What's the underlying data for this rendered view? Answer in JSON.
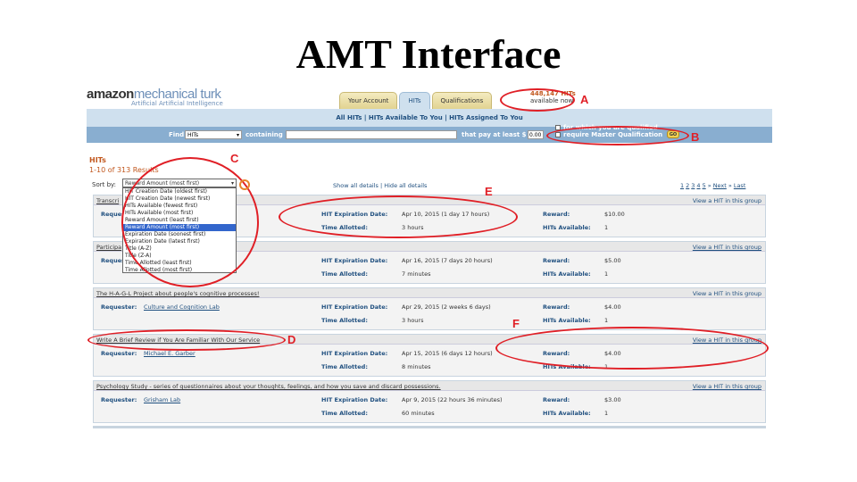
{
  "slide_title": "AMT Interface",
  "logo": {
    "main": "amazon",
    "accent": "mechanical turk",
    "tagline": "Artificial Artificial Intelligence"
  },
  "tabs": [
    "Your Account",
    "HITs",
    "Qualifications"
  ],
  "hit_count": {
    "number": "448,147 HITs",
    "label": "available now"
  },
  "nav": "All HITs  |  HITs Available To You  |  HITs Assigned To You",
  "find": {
    "find_label": "Find",
    "select_value": "HITs",
    "containing_label": "containing",
    "pay_label": "that pay at least $",
    "pay_value": "0.00",
    "qual1": "for which you are qualified",
    "qual2": "require Master Qualification",
    "go": "GO"
  },
  "heading": "HITs",
  "results": "1-10 of 313 Results",
  "sort": {
    "label": "Sort by:",
    "value": "Reward Amount (most first)",
    "options": [
      "HIT Creation Date (oldest first)",
      "HIT Creation Date (newest first)",
      "HITs Available (fewest first)",
      "HITs Available (most first)",
      "Reward Amount (least first)",
      "Reward Amount (most first)",
      "Expiration Date (soonest first)",
      "Expiration Date (latest first)",
      "Title (A-Z)",
      "Title (Z-A)",
      "Time Allotted (least first)",
      "Time Allotted (most first)"
    ]
  },
  "details": "Show all details  |  Hide all details",
  "pager": [
    "1",
    "2",
    "3",
    "4",
    "5",
    "»",
    "Next",
    "»",
    "Last"
  ],
  "labels": {
    "requester": "Requester:",
    "expiration": "HIT Expiration Date:",
    "allotted": "Time Allotted:",
    "reward": "Reward:",
    "available": "HITs Available:"
  },
  "hits": [
    {
      "title": "Transcri",
      "view": "View a HIT in this group",
      "requester": "",
      "expiration": "Apr 10, 2015  (1 day 17 hours)",
      "allotted": "3 hours",
      "reward": "$10.00",
      "available": "1"
    },
    {
      "title": "Participa",
      "view": "View a HIT in this group",
      "requester": "",
      "expiration": "Apr 16, 2015  (7 days 20 hours)",
      "allotted": "7 minutes",
      "reward": "$5.00",
      "available": "1"
    },
    {
      "title": "The H-A-G-L Project about people's cognitive processes!",
      "view": "View a HIT in this group",
      "requester": "Culture and Cognition Lab",
      "expiration": "Apr 29, 2015  (2 weeks 6 days)",
      "allotted": "3 hours",
      "reward": "$4.00",
      "available": "1"
    },
    {
      "title": "Write A Brief Review if You Are Familiar With Our Service",
      "view": "View a HIT in this group",
      "requester": "Michael E. Garber",
      "expiration": "Apr 15, 2015  (6 days 12 hours)",
      "allotted": "8 minutes",
      "reward": "$4.00",
      "available": "1"
    },
    {
      "title": "Psychology Study - series of questionnaires about your thoughts, feelings, and how you save and discard possessions.",
      "view": "View a HIT in this group",
      "requester": "Grisham Lab",
      "expiration": "Apr 9, 2015  (22 hours 36 minutes)",
      "allotted": "60 minutes",
      "reward": "$3.00",
      "available": "1"
    }
  ],
  "annotations": [
    "A",
    "B",
    "C",
    "D",
    "E",
    "F"
  ],
  "colors": {
    "annotation": "#e01f26",
    "nav_bg": "#cfe0ee",
    "find_bg": "#89aed0",
    "accent_orange": "#c2581f",
    "link_blue": "#1f4f7f"
  }
}
